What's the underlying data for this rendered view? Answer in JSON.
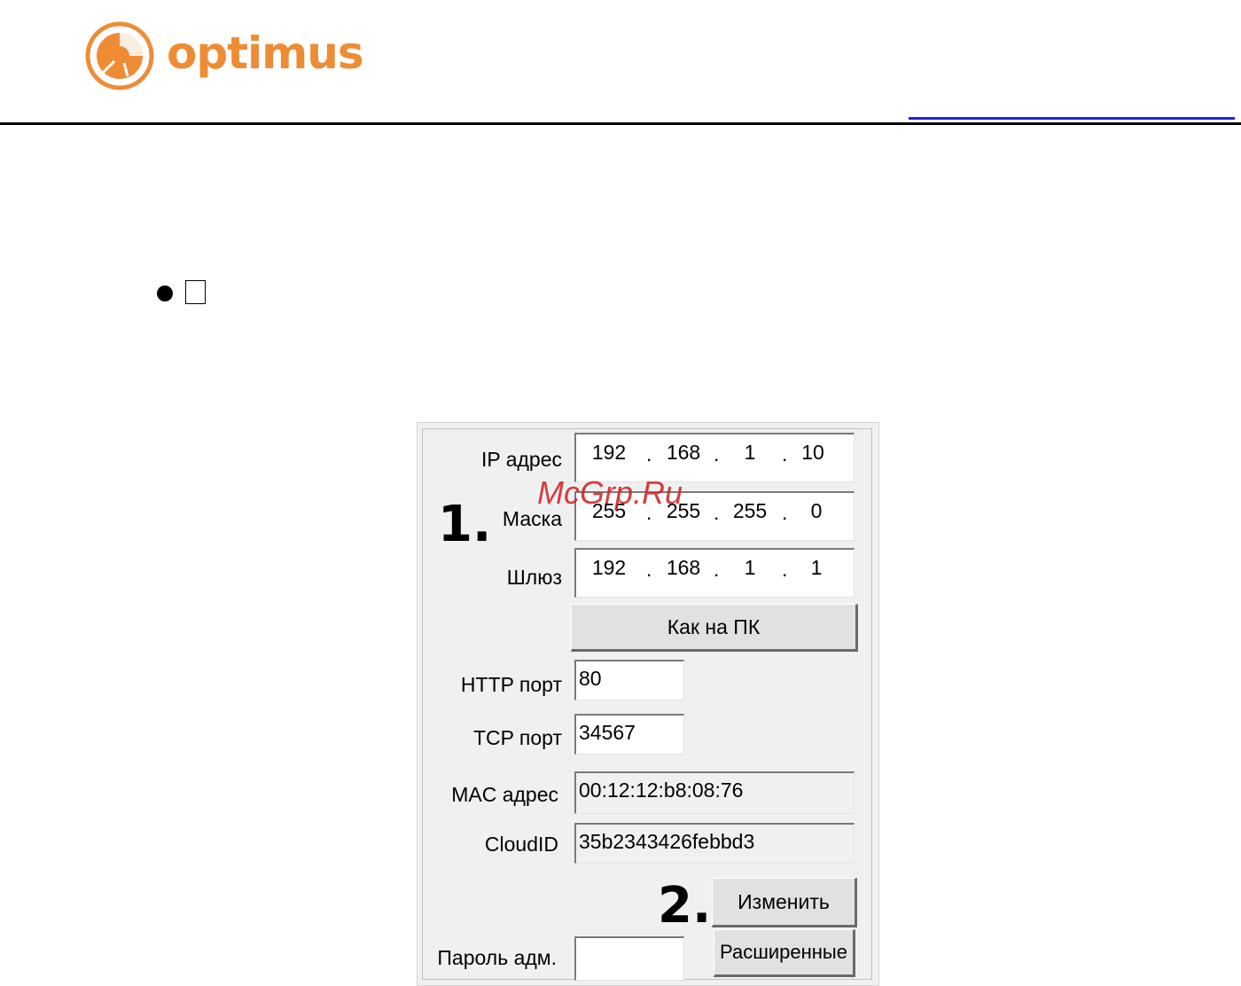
{
  "brand": {
    "name": "optimus",
    "color": "#ee8c36"
  },
  "header": {
    "rule_color": "#000000",
    "link_line_color": "#2222dd"
  },
  "panel": {
    "step1": "1.",
    "step2": "2.",
    "ip": {
      "label": "IP адрес",
      "octets": [
        "192",
        "168",
        "1",
        "10"
      ]
    },
    "mask": {
      "label": "Маска",
      "octets": [
        "255",
        "255",
        "255",
        "0"
      ]
    },
    "gateway": {
      "label": "Шлюз",
      "octets": [
        "192",
        "168",
        "1",
        "1"
      ]
    },
    "as_pc_button": "Как на ПК",
    "http": {
      "label": "HTTP порт",
      "value": "80"
    },
    "tcp": {
      "label": "TCP порт",
      "value": "34567"
    },
    "mac": {
      "label": "MAC адрес",
      "value": "00:12:12:b8:08:76"
    },
    "cloud": {
      "label": "CloudID",
      "value": "35b2343426febbd3"
    },
    "change_button": "Изменить",
    "advanced_button": "Расширенные",
    "password": {
      "label": "Пароль адм.",
      "value": ""
    }
  },
  "watermark": "McGrp.Ru"
}
